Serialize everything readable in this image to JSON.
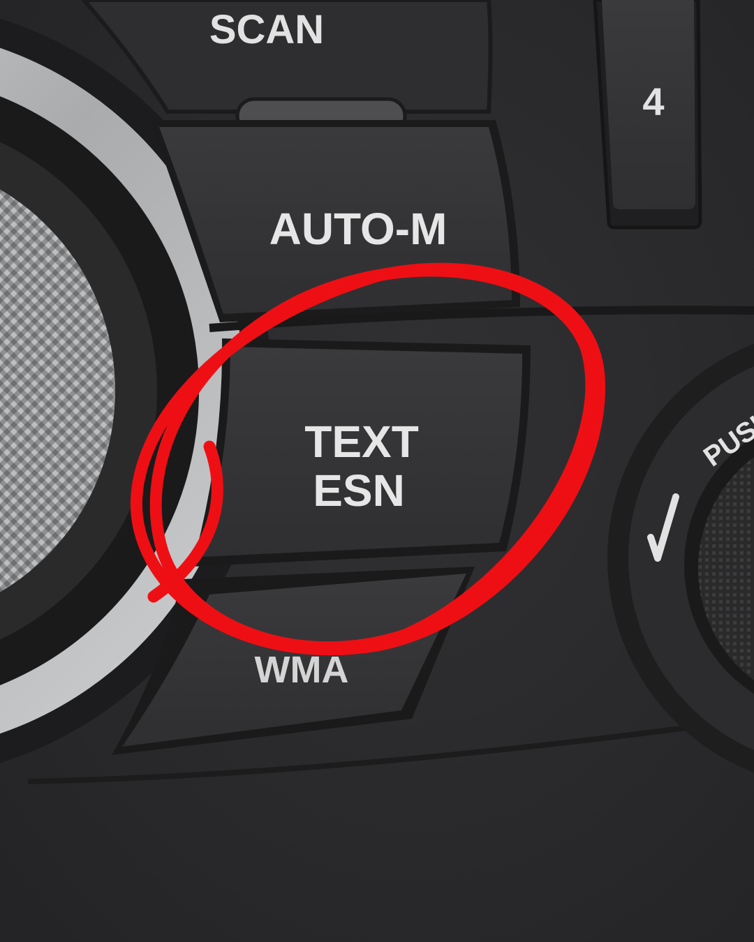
{
  "buttons": {
    "scan": "SCAN",
    "preset_4": "4",
    "auto_m": "AUTO-M",
    "text_line1": "TEXT",
    "text_line2": "ESN",
    "wma": "WMA"
  },
  "knob": {
    "push_label": "PUSH"
  },
  "annotation": {
    "shape": "hand-drawn circle",
    "color": "#ee0f14",
    "target": "TEXT ESN button"
  },
  "colors": {
    "panel": "#2b2b2d",
    "button": "#343436",
    "button_dark": "#1e1e20",
    "chrome_ring": "#b9bbbd",
    "label": "#e6e6e6"
  }
}
